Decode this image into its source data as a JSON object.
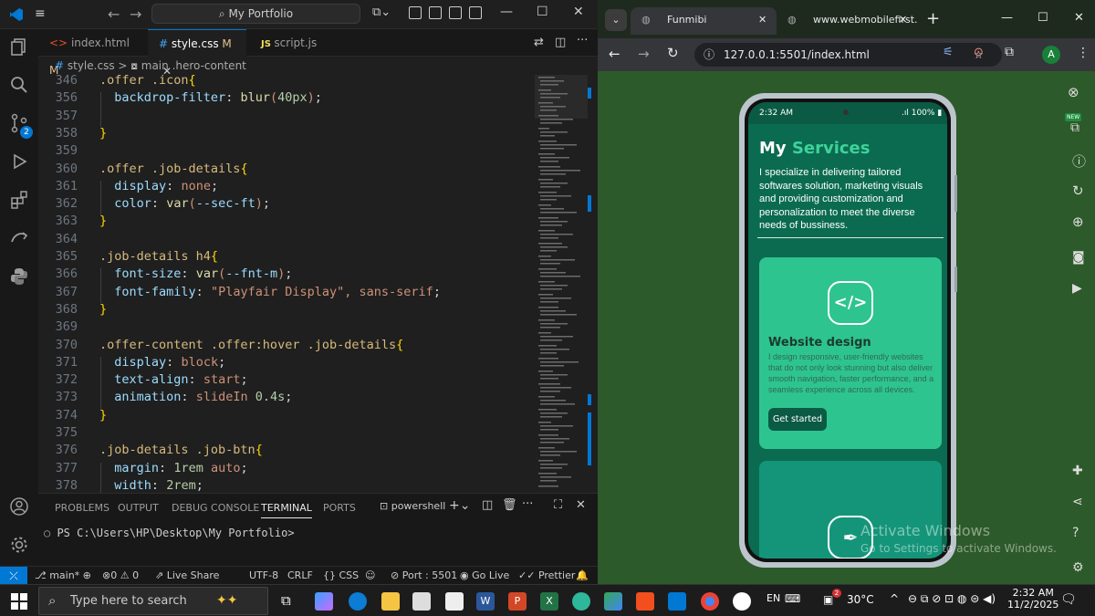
{
  "vscode": {
    "search_text": "My Portfolio",
    "tabs": [
      {
        "label": "index.html",
        "badge": "M",
        "lang_icon": "html-icon"
      },
      {
        "label": "style.css",
        "badge": "M",
        "lang_icon": "css-icon"
      },
      {
        "label": "script.js",
        "badge": "",
        "lang_icon": "js-icon"
      }
    ],
    "breadcrumb": {
      "file": "style.css",
      "sep": ">",
      "symbol": "main .hero-content"
    },
    "code_lines": [
      {
        "n": "346",
        "text": ".offer .icon{"
      },
      {
        "n": "356",
        "text": "  backdrop-filter: blur(40px);"
      },
      {
        "n": "357",
        "text": ""
      },
      {
        "n": "358",
        "text": "}"
      },
      {
        "n": "359",
        "text": ""
      },
      {
        "n": "360",
        "text": ".offer .job-details{"
      },
      {
        "n": "361",
        "text": "  display: none;"
      },
      {
        "n": "362",
        "text": "  color: var(--sec-ft);"
      },
      {
        "n": "363",
        "text": "}"
      },
      {
        "n": "364",
        "text": ""
      },
      {
        "n": "365",
        "text": ".job-details h4{"
      },
      {
        "n": "366",
        "text": "  font-size: var(--fnt-m);"
      },
      {
        "n": "367",
        "text": "  font-family: \"Playfair Display\", sans-serif;"
      },
      {
        "n": "368",
        "text": "}"
      },
      {
        "n": "369",
        "text": ""
      },
      {
        "n": "370",
        "text": ".offer-content .offer:hover .job-details{"
      },
      {
        "n": "371",
        "text": "  display: block;"
      },
      {
        "n": "372",
        "text": "  text-align: start;"
      },
      {
        "n": "373",
        "text": "  animation: slideIn 0.4s;"
      },
      {
        "n": "374",
        "text": "}"
      },
      {
        "n": "375",
        "text": ""
      },
      {
        "n": "376",
        "text": ".job-details .job-btn{"
      },
      {
        "n": "377",
        "text": "  margin: 1rem auto;"
      },
      {
        "n": "378",
        "text": "  width: 2rem;"
      }
    ],
    "panel_tabs": [
      "PROBLEMS",
      "OUTPUT",
      "DEBUG CONSOLE",
      "TERMINAL",
      "PORTS"
    ],
    "terminal_name": "powershell",
    "terminal_prompt": "PS C:\\Users\\HP\\Desktop\\My Portfolio>",
    "status": {
      "branch": "main*",
      "errors": "0",
      "warnings": "0",
      "live_share": "Live Share",
      "encoding": "UTF-8",
      "eol": "CRLF",
      "language": "CSS",
      "port": "Port : 5501",
      "go_live": "Go Live",
      "prettier": "Prettier"
    },
    "scm_badge": "2"
  },
  "chrome": {
    "tabs": [
      {
        "title": "Funmibi"
      },
      {
        "title": "www.webmobilefirst."
      }
    ],
    "url": "127.0.0.1:5501/index.html",
    "profile_initial": "A",
    "new_badge": "NEW"
  },
  "phone": {
    "time": "2:32 AM",
    "battery": "100%",
    "heading_white": "My",
    "heading_accent": "Services",
    "intro": "I specialize in delivering tailored softwares solution, marketing visuals and providing customization and personalization to meet the diverse needs of bussiness.",
    "card1_title": "Website design",
    "card1_text": "I design responsive, user-friendly websites that do not only look stunning but also deliver smooth navigation, faster performance, and a seamless experience across all devices.",
    "card1_button": "Get started",
    "watermark_1": "Activate Windows",
    "watermark_2": "Go to Settings to activate Windows."
  },
  "taskbar": {
    "search_placeholder": "Type here to search",
    "temperature": "30°C",
    "lang": "EN",
    "time": "2:32 AM",
    "date": "11/2/2025",
    "weather_badge": "2"
  },
  "colors": {
    "vscode_blue": "#0078d4",
    "accent_green": "#2ec48f",
    "page_bg": "#2d5a2a"
  }
}
